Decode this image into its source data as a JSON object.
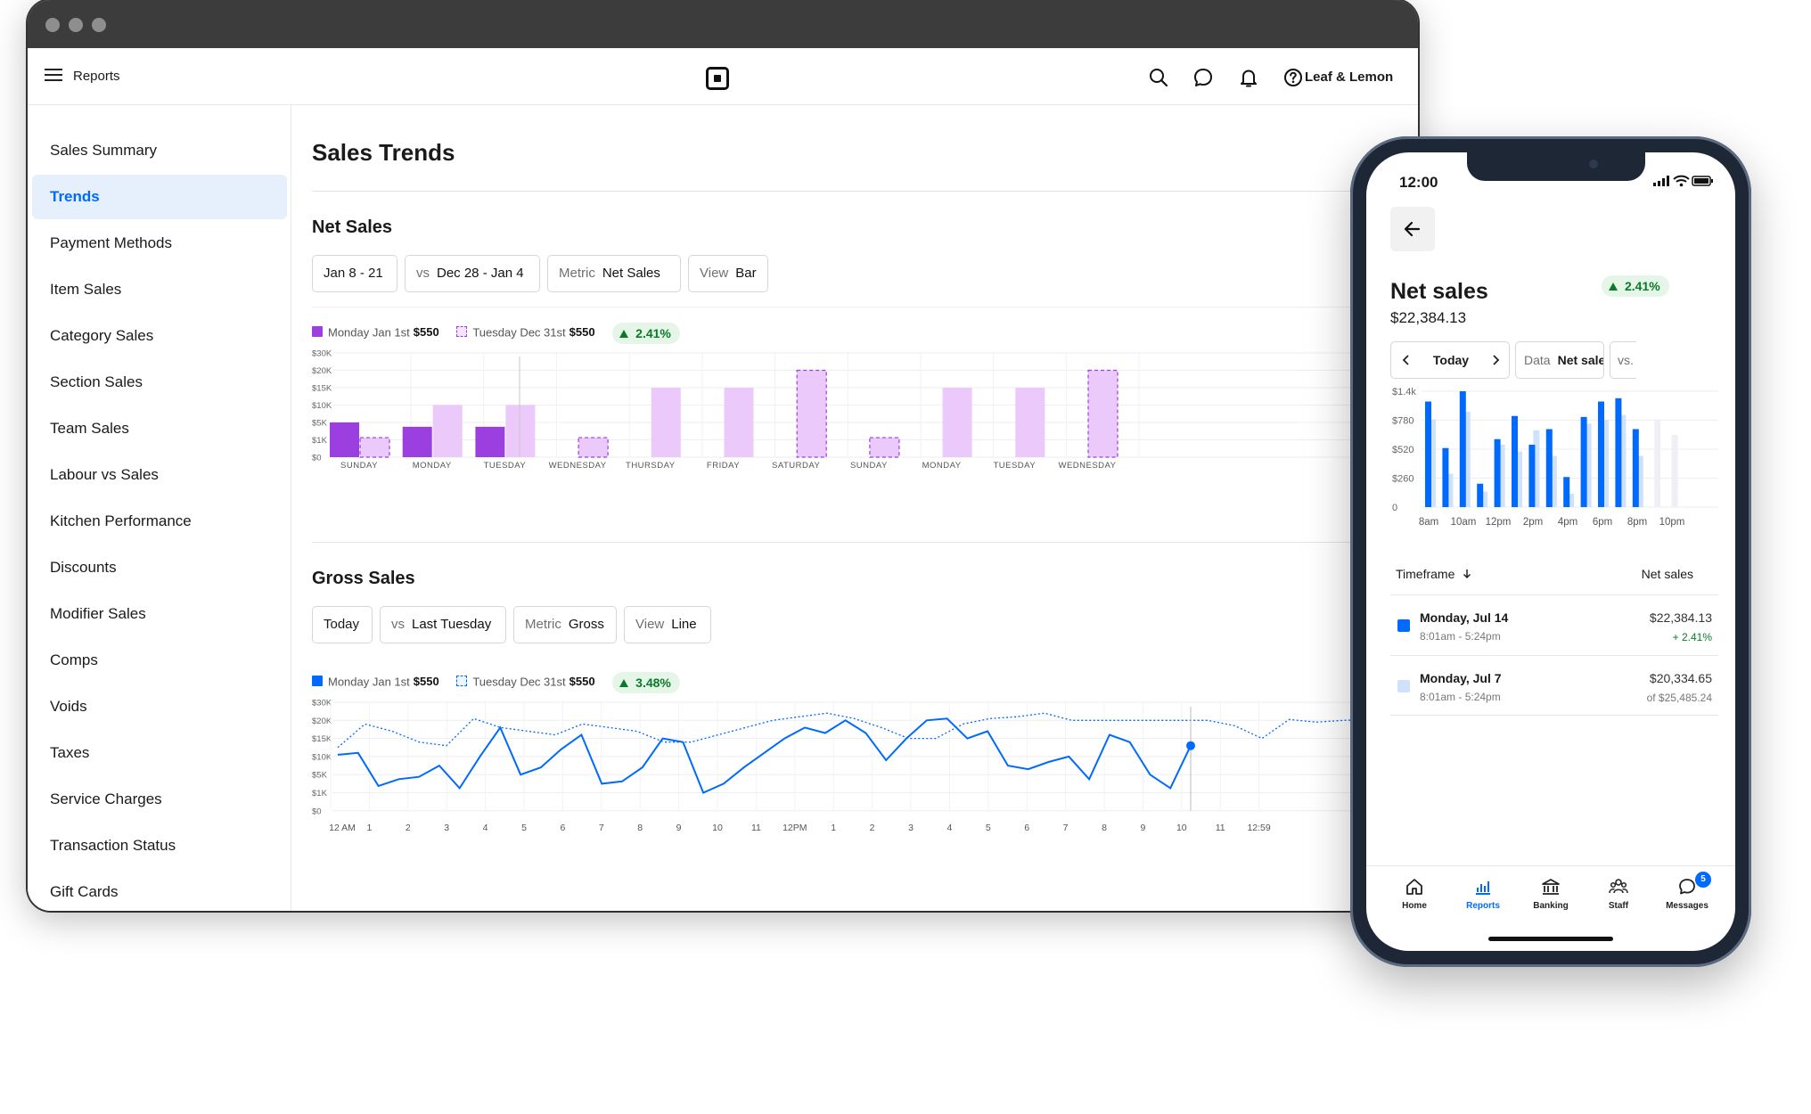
{
  "app": {
    "title": "Reports",
    "merchant": "Leaf & Lemon"
  },
  "sidebar": {
    "items": [
      {
        "label": "Sales Summary"
      },
      {
        "label": "Trends",
        "active": true
      },
      {
        "label": "Payment Methods"
      },
      {
        "label": "Item Sales"
      },
      {
        "label": "Category Sales"
      },
      {
        "label": "Section Sales"
      },
      {
        "label": "Team Sales"
      },
      {
        "label": "Labour vs Sales"
      },
      {
        "label": "Kitchen Performance"
      },
      {
        "label": "Discounts"
      },
      {
        "label": "Modifier Sales"
      },
      {
        "label": "Comps"
      },
      {
        "label": "Voids"
      },
      {
        "label": "Taxes"
      },
      {
        "label": "Service Charges"
      },
      {
        "label": "Transaction Status"
      },
      {
        "label": "Gift Cards"
      }
    ]
  },
  "main": {
    "title": "Sales Trends",
    "net_sales": {
      "title": "Net Sales",
      "filters": {
        "date": "Jan 8 - 21",
        "vs_label": "vs",
        "vs_value": "Dec 28 - Jan 4",
        "metric_label": "Metric",
        "metric_value": "Net Sales",
        "view_label": "View",
        "view_value": "Bar"
      },
      "legend": {
        "current_label": "Monday Jan 1st",
        "current_value": "$550",
        "previous_label": "Tuesday Dec 31st",
        "previous_value": "$550",
        "change": "2.41%"
      }
    },
    "gross_sales": {
      "title": "Gross Sales",
      "filters": {
        "date": "Today",
        "vs_label": "vs",
        "vs_value": "Last Tuesday",
        "metric_label": "Metric",
        "metric_value": "Gross",
        "view_label": "View",
        "view_value": "Line"
      },
      "legend": {
        "current_label": "Monday Jan 1st",
        "current_value": "$550",
        "previous_label": "Tuesday Dec 31st",
        "previous_value": "$550",
        "change": "3.48%"
      }
    }
  },
  "phone": {
    "time": "12:00",
    "title": "Net sales",
    "amount": "$22,384.13",
    "change": "2.41%",
    "timeframe_chip": "Today",
    "data_label": "Data",
    "data_value": "Net sales",
    "vs_chip": "vs.",
    "table": {
      "col_left": "Timeframe",
      "col_right": "Net sales",
      "rows": [
        {
          "title": "Monday, Jul 14",
          "time": "8:01am - 5:24pm",
          "value": "$22,384.13",
          "sub": "+ 2.41%"
        },
        {
          "title": "Monday, Jul 7",
          "time": "8:01am - 5:24pm",
          "value": "$20,334.65",
          "sub": "of $25,485.24"
        }
      ]
    },
    "tabs": [
      {
        "label": "Home",
        "icon": "home-icon"
      },
      {
        "label": "Reports",
        "icon": "reports-icon",
        "active": true
      },
      {
        "label": "Banking",
        "icon": "bank-icon"
      },
      {
        "label": "Staff",
        "icon": "staff-icon"
      },
      {
        "label": "Messages",
        "icon": "messages-icon",
        "badge": "5"
      }
    ]
  },
  "colors": {
    "accent": "#006aff",
    "purple_current": "#9b3fe0",
    "purple_previous": "#ebc9fb",
    "blue_current": "#006aff",
    "blue_previous": "#cfe1fb",
    "positive": "#0b7a26"
  },
  "chart_data": [
    {
      "type": "bar",
      "title": "Net Sales",
      "y_ticks": [
        "$30K",
        "$20K",
        "$15K",
        "$10K",
        "$5K",
        "$1K",
        "$0"
      ],
      "categories": [
        "SUNDAY",
        "MONDAY",
        "TUESDAY",
        "WEDNESDAY",
        "THURSDAY",
        "FRIDAY",
        "SATURDAY",
        "SUNDAY",
        "MONDAY",
        "TUESDAY",
        "WEDNESDAY"
      ],
      "series": [
        {
          "name": "Monday Jan 1st",
          "values": [
            5,
            4,
            4,
            null,
            null,
            null,
            null,
            null,
            null,
            null,
            null
          ]
        },
        {
          "name": "Tuesday Dec 31st",
          "values": [
            1.5,
            10,
            10,
            1.5,
            15,
            15,
            20,
            1.5,
            15,
            15,
            20
          ],
          "dashed": [
            true,
            false,
            false,
            true,
            false,
            false,
            true,
            true,
            false,
            false,
            true
          ]
        }
      ]
    },
    {
      "type": "line",
      "title": "Gross Sales",
      "y_ticks": [
        "$30K",
        "$20K",
        "$15K",
        "$10K",
        "$5K",
        "$1K",
        "$0"
      ],
      "x_ticks": [
        "12 AM",
        "1",
        "2",
        "3",
        "4",
        "5",
        "6",
        "7",
        "8",
        "9",
        "10",
        "11",
        "12PM",
        "1",
        "2",
        "3",
        "4",
        "5",
        "6",
        "7",
        "8",
        "9",
        "10",
        "11",
        "12:59"
      ],
      "series": [
        {
          "name": "Monday Jan 1st",
          "values": [
            10.5,
            11,
            2.5,
            4,
            4.5,
            7.5,
            2,
            10,
            18,
            5,
            7,
            12,
            16,
            3,
            3.5,
            7,
            15,
            14,
            1,
            3,
            7,
            11,
            15,
            18,
            16.5,
            20,
            16.5,
            9,
            15,
            20,
            21,
            15,
            17,
            7.5,
            6.5,
            8.5,
            10,
            4,
            16,
            14,
            5,
            2,
            13
          ]
        },
        {
          "name": "Tuesday Dec 31st",
          "values": [
            12.5,
            19,
            17,
            14,
            13,
            21,
            18,
            17,
            16,
            19,
            18,
            17,
            14,
            14,
            16,
            18,
            20,
            22,
            24,
            21,
            18,
            15,
            15,
            19,
            21,
            22,
            24,
            20,
            20,
            20,
            20,
            20,
            20,
            18.5,
            15,
            20.5,
            19.5,
            20,
            20.5,
            20,
            18.5
          ]
        }
      ]
    },
    {
      "type": "bar",
      "title": "Net sales",
      "y_ticks": [
        "$1.4k",
        "$780",
        "$520",
        "$260",
        "0"
      ],
      "x_ticks": [
        "8am",
        "10am",
        "12pm",
        "2pm",
        "4pm",
        "6pm",
        "8pm",
        "10pm"
      ],
      "series": [
        {
          "name": "Monday, Jul 14",
          "values": [
            1180,
            530,
            1400,
            210,
            610,
            870,
            560,
            700,
            270,
            850,
            1180,
            1250,
            700,
            0,
            0
          ]
        },
        {
          "name": "Monday, Jul 7",
          "values": [
            800,
            300,
            960,
            140,
            560,
            500,
            690,
            460,
            120,
            750,
            790,
            890,
            460,
            800,
            650
          ]
        }
      ]
    }
  ]
}
